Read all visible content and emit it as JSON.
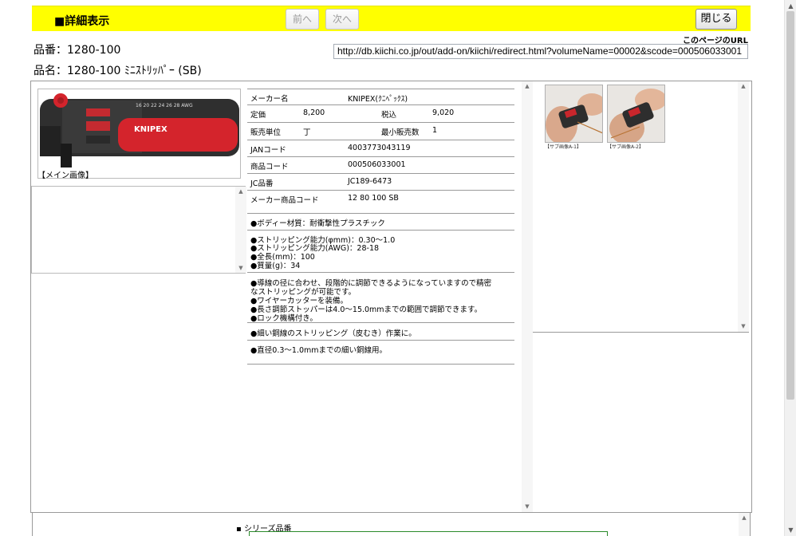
{
  "header": {
    "title": "■詳細表示",
    "prev_label": "前へ",
    "next_label": "次へ",
    "close_label": "閉じる"
  },
  "product": {
    "number_line": "品番：1280-100",
    "name_line": "品名：1280-100 ﾐﾆｽﾄﾘｯﾊﾟｰ (SB)"
  },
  "url": {
    "label": "このページのURL",
    "value": "http://db.kiichi.co.jp/out/add-on/kiichi/redirect.html?volumeName=00002&scode=000506033001"
  },
  "main_image": {
    "caption": "【メイン画像】",
    "brand_text": "KNIPEX",
    "scale_text": "16 20 22 24 26 28 AWG"
  },
  "specs": {
    "maker_label": "メーカー名",
    "maker_value": "KNIPEX(ｸﾆﾍﾟｯｸｽ)",
    "price_label": "定価",
    "price_value": "8,200",
    "taxin_label": "税込",
    "taxin_value": "9,020",
    "unit_label": "販売単位",
    "unit_value": "丁",
    "min_label": "最小販売数",
    "min_value": "1",
    "jan_label": "JANコード",
    "jan_value": "4003773043119",
    "code_label": "商品コード",
    "code_value": "000506033001",
    "jc_label": "JC品番",
    "jc_value": "JC189-6473",
    "maker_code_label": "メーカー商品コード",
    "maker_code_value": "12 80 100 SB"
  },
  "description": {
    "material": "●ボディー材質：耐衝撃性プラスチック",
    "cap1": "●ストリッピング能力(φmm)：0.30～1.0",
    "cap2": "●ストリッピング能力(AWG)：28-18",
    "length": "●全長(mm)：100",
    "weight": "●質量(g)：34",
    "feat1a": "●導線の径に合わせ、段階的に調節できるようになっていますので精密",
    "feat1b": "なストリッピングが可能です。",
    "feat2": "●ワイヤーカッターを装備。",
    "feat3": "●長さ調節ストッパーは4.0～15.0mmまでの範囲で調節できます。",
    "feat4": "●ロック機構付き。",
    "usage": "●細い銅線のストリッピング（皮むき）作業に。",
    "spec": "●直径0.3～1.0mmまでの細い銅線用。"
  },
  "sub_images": [
    {
      "caption": "【サブ画像A-1】"
    },
    {
      "caption": "【サブ画像A-2】"
    }
  ],
  "series": {
    "label": "シリーズ品番"
  },
  "colors": {
    "header_bg": "#ffff00",
    "tool_red": "#d4242c",
    "tool_dark": "#2b2b2b",
    "series_border": "#2a8a2a"
  }
}
